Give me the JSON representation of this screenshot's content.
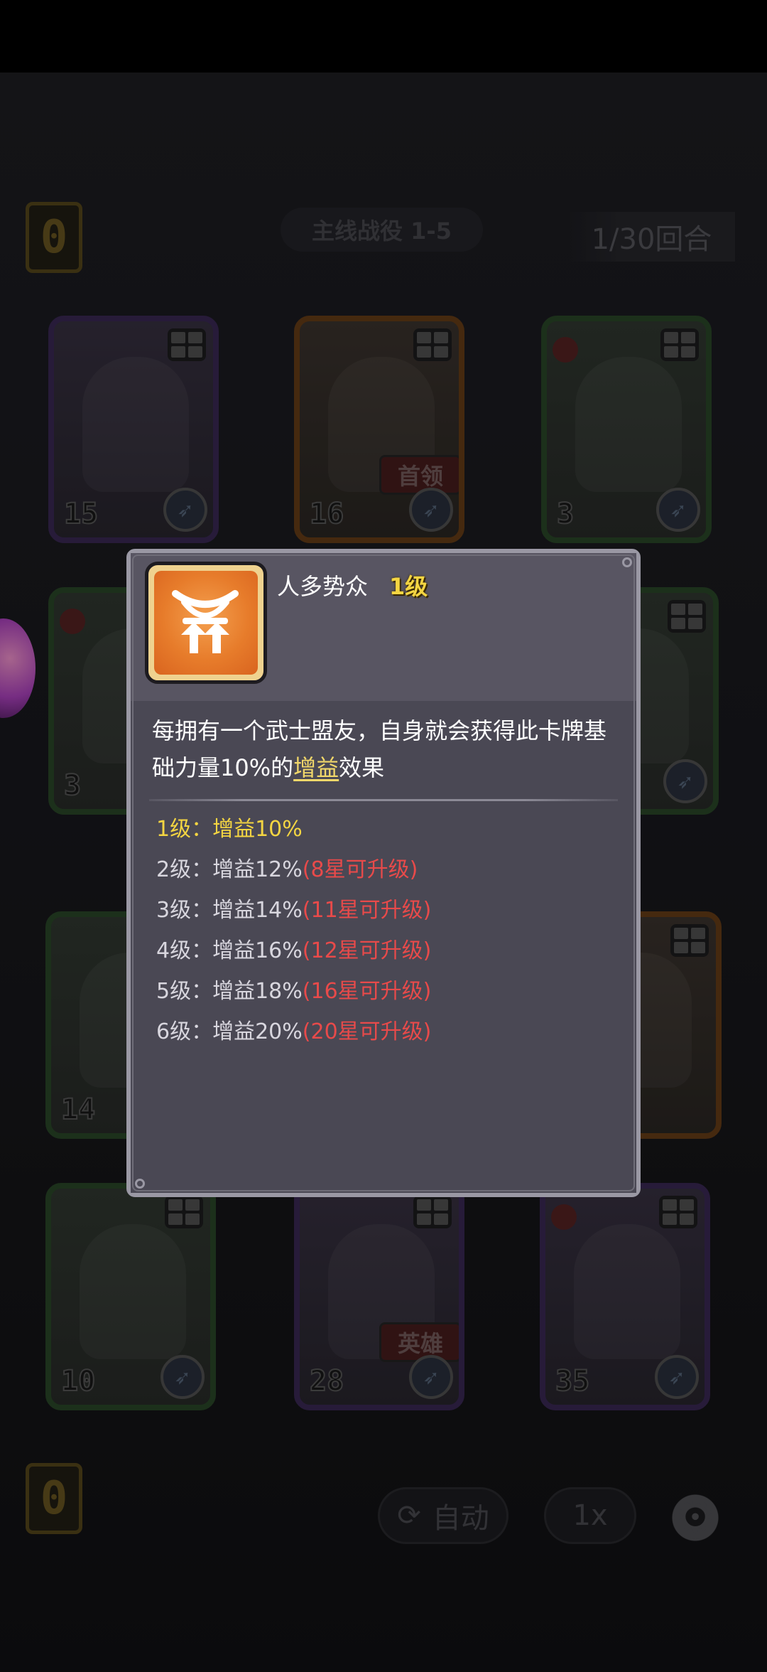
{
  "hud": {
    "left_counter_top": "0",
    "left_counter_bottom": "0",
    "stage_title": "主线战役 1-5",
    "round_counter": "1/30回合",
    "auto_button": "自动",
    "speed_button": "1x"
  },
  "board": {
    "cards": [
      {
        "level": "15",
        "tag": ""
      },
      {
        "level": "16",
        "tag": "首领"
      },
      {
        "level": "3",
        "tag": ""
      },
      {
        "level": "3",
        "tag": ""
      },
      {
        "level": "14",
        "tag": ""
      },
      {
        "level": "10",
        "tag": ""
      },
      {
        "level": "28",
        "tag": "英雄"
      },
      {
        "level": "35",
        "tag": ""
      }
    ]
  },
  "popup": {
    "skill_name": "人多势众",
    "skill_level": "1级",
    "description_part1": "每拥有一个武士盟友，自身就会获得此卡牌基础力量10%的",
    "description_keyword": "增益",
    "description_part2": "效果",
    "levels": [
      {
        "label": "1级：增益10%",
        "requirement": ""
      },
      {
        "label": "2级：增益12%",
        "requirement": "(8星可升级)"
      },
      {
        "label": "3级：增益14%",
        "requirement": "(11星可升级)"
      },
      {
        "label": "4级：增益16%",
        "requirement": "(12星可升级)"
      },
      {
        "label": "5级：增益18%",
        "requirement": "(16星可升级)"
      },
      {
        "label": "6级：增益20%",
        "requirement": "(20星可升级)"
      }
    ]
  },
  "colors": {
    "current_level": "#f4d542",
    "requirement_red": "#e84a4a",
    "keyword_gold": "#f2d86a",
    "popup_bg": "#4f4d59"
  },
  "icons": [
    "skill-samurai-ally-icon",
    "rocket-icon",
    "grid-icon",
    "gear-icon",
    "refresh-icon"
  ]
}
